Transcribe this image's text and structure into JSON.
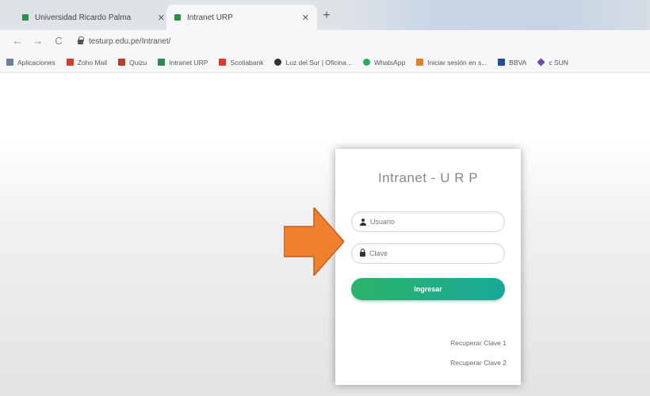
{
  "browser": {
    "tabs": [
      {
        "label": "Universidad Ricardo Palma",
        "close": "✕"
      },
      {
        "label": "Intranet URP",
        "close": "✕"
      }
    ],
    "new_tab": "+",
    "nav": {
      "back": "←",
      "forward": "→",
      "reload": "C"
    },
    "url": "testurp.edu.pe/Intranet/"
  },
  "bookmarks": [
    {
      "label": "Aplicaciones",
      "color": "#6b7fa3"
    },
    {
      "label": "Zoho Mail",
      "color": "#d33b2c"
    },
    {
      "label": "Quizu",
      "color": "#c0392b"
    },
    {
      "label": "Intranet URP",
      "color": "#2e8b4a"
    },
    {
      "label": "Scotiabank",
      "color": "#e03a2f"
    },
    {
      "label": "Luz del Sur | Oficina...",
      "color": "#333333"
    },
    {
      "label": "WhatsApp",
      "color": "#27ae60"
    },
    {
      "label": "Iniciar sesión en s...",
      "color": "#e67e22"
    },
    {
      "label": "BBVA",
      "color": "#1f4e99"
    },
    {
      "label": "c SUN",
      "color": "#6b4fa3"
    }
  ],
  "login": {
    "title": "Intranet - U R P",
    "username_placeholder": "Usuario",
    "password_placeholder": "Clave",
    "submit_label": "Ingresar",
    "recover_1": "Recuperar Clave 1",
    "recover_2": "Recuperar Clave 2"
  },
  "colors": {
    "accent_start": "#2bb36a",
    "accent_end": "#19a89a",
    "arrow": "#f07f2e"
  }
}
